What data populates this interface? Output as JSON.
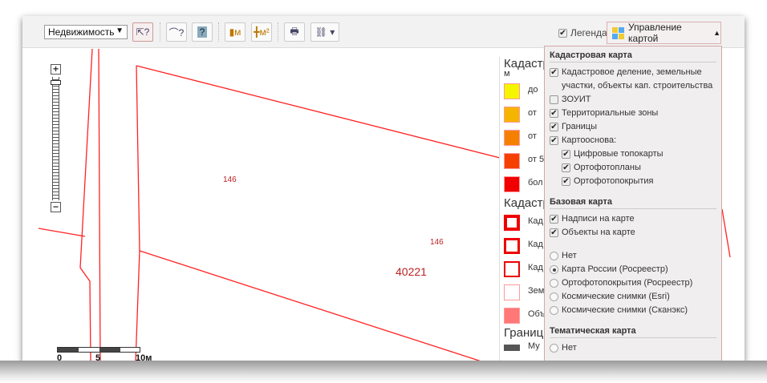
{
  "toolbar": {
    "category_select": "Недвижимость",
    "legend_label": "Легенда",
    "legend_checked": true,
    "map_control_label": "Управление картой"
  },
  "map": {
    "labels": [
      "146",
      "146",
      "40221"
    ],
    "scale": {
      "ticks": [
        "0",
        "5",
        "10м"
      ]
    }
  },
  "legend": {
    "heading1": "Кадастр",
    "unit": "м",
    "color_rows": [
      {
        "color": "#f5f500",
        "text": "до"
      },
      {
        "color": "#f5b400",
        "text": "от"
      },
      {
        "color": "#f58000",
        "text": "от"
      },
      {
        "color": "#f54000",
        "text": "от 5"
      },
      {
        "color": "#f00000",
        "text": "бол"
      }
    ],
    "heading2": "Кадастр",
    "outline_rows": [
      {
        "text": "Кад"
      },
      {
        "text": "Кад"
      },
      {
        "text": "Кад"
      },
      {
        "text": "Зем"
      },
      {
        "text": "Объ"
      }
    ],
    "heading3": "Границы",
    "bottom_row": "Му"
  },
  "panel": {
    "cadastral": {
      "title": "Кадастровая карта",
      "items": [
        {
          "label": "Кадастровое деление, земельные участки, объекты кап. строительства",
          "checked": true
        },
        {
          "label": "ЗОУИТ",
          "checked": false
        },
        {
          "label": "Территориальные зоны",
          "checked": true
        },
        {
          "label": "Границы",
          "checked": true
        },
        {
          "label": "Картооснова:",
          "checked": true
        }
      ],
      "sub_items": [
        {
          "label": "Цифровые топокарты",
          "checked": true
        },
        {
          "label": "Ортофотопланы",
          "checked": true
        },
        {
          "label": "Ортофотопокрытия",
          "checked": true
        }
      ]
    },
    "base": {
      "title": "Базовая карта",
      "checks": [
        {
          "label": "Надписи на карте",
          "checked": true
        },
        {
          "label": "Объекты на карте",
          "checked": true
        }
      ],
      "radios": [
        {
          "label": "Нет",
          "selected": false
        },
        {
          "label": "Карта России (Росреестр)",
          "selected": true
        },
        {
          "label": "Ортофотопокрытия (Росреестр)",
          "selected": false
        },
        {
          "label": "Космические снимки (Esri)",
          "selected": false
        },
        {
          "label": "Космические снимки (Сканэкс)",
          "selected": false
        }
      ]
    },
    "thematic": {
      "title": "Тематическая карта",
      "radios": [
        {
          "label": "Нет",
          "selected": false
        }
      ]
    }
  }
}
